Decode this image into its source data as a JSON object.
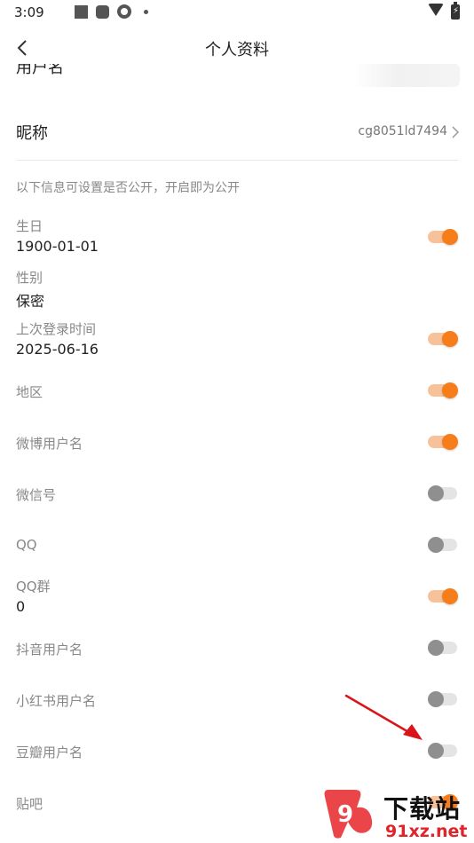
{
  "status_bar": {
    "time": "3:09",
    "icons": [
      "square-icon",
      "rounded-square-icon",
      "gear-icon",
      "dot-icon",
      "wifi-icon",
      "battery-icon"
    ]
  },
  "header": {
    "title": "个人资料",
    "back_icon": "chevron-left-icon"
  },
  "username": {
    "label": "用户名"
  },
  "nickname": {
    "label": "昵称",
    "value": "cg8051ld7494"
  },
  "privacy_hint": "以下信息可设置是否公开，开启即为公开",
  "fields": [
    {
      "label": "生日",
      "value": "1900-01-01",
      "public": true
    },
    {
      "label": "性别",
      "value": "保密"
    },
    {
      "label": "上次登录时间",
      "value": "2025-06-16",
      "public": true
    },
    {
      "label": "地区",
      "public": true
    },
    {
      "label": "微博用户名",
      "public": true
    },
    {
      "label": "微信号",
      "public": false
    },
    {
      "label": "QQ",
      "public": false
    },
    {
      "label": "QQ群",
      "value": "0",
      "public": true
    },
    {
      "label": "抖音用户名",
      "public": false
    },
    {
      "label": "小红书用户名",
      "public": false
    },
    {
      "label": "豆瓣用户名",
      "public": false
    },
    {
      "label": "贴吧",
      "public": true
    }
  ],
  "colors": {
    "accent": "#f77d1b",
    "accent_track": "#f7c29a",
    "off_knob": "#8f8f8f",
    "off_track": "#e4e4e4",
    "annotation_arrow": "#d9151b"
  },
  "watermark": {
    "top": "下载站",
    "bottom": "91xz.net"
  }
}
